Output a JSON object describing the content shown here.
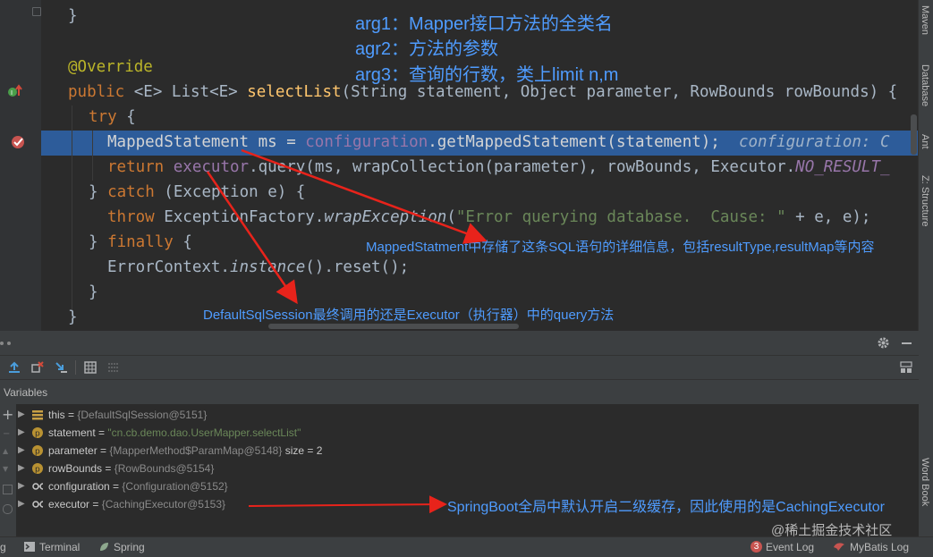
{
  "editor": {
    "lines": {
      "l0": "}",
      "l2_annotation": "@Override",
      "l3": {
        "kw": "public",
        "generic1": "<E>",
        "type": "List",
        "generic2": "<E>",
        "method": "selectList",
        "params": "(String statement, Object parameter, RowBounds rowBounds) {"
      },
      "l4": {
        "kw": "try",
        "rest": " {"
      },
      "l5": {
        "type": "MappedStatement",
        "var": " ms = ",
        "field": "configuration",
        "call": ".getMappedStatement(statement);",
        "hint": "configuration: C"
      },
      "l6": {
        "kw": "return",
        "field": "executor",
        "call": ".query(ms, wrapCollection(parameter), rowBounds, Executor.",
        "const": "NO_RESULT_"
      },
      "l7": {
        "pre": "} ",
        "kw": "catch",
        "rest": " (Exception e) {"
      },
      "l8": {
        "kw": "throw",
        "cls": " ExceptionFactory.",
        "method": "wrapException",
        "open": "(",
        "str": "\"Error querying database.  Cause: \"",
        "rest": " + e, e);"
      },
      "l9": {
        "pre": "} ",
        "kw": "finally",
        "rest": " {"
      },
      "l10": {
        "cls": "ErrorContext.",
        "method": "instance",
        "rest": "().reset();"
      },
      "l11": "}",
      "l12": "}"
    }
  },
  "notes": {
    "arg1": "arg1：Mapper接口方法的全类名",
    "arg2": "agr2：方法的参数",
    "arg3": "arg3：查询的行数，类上limit n,m",
    "mapped": "MappedStatment中存储了这条SQL语句的详细信息，包括resultType,resultMap等内容",
    "default": "DefaultSqlSession最终调用的还是Executor（执行器）中的query方法",
    "springboot": "SpringBoot全局中默认开启二级缓存，因此使用的是CachingExecutor"
  },
  "right_tabs": {
    "maven": "Maven",
    "database": "Database",
    "ant": "Ant",
    "structure": "Z: Structure",
    "wordbook": "Word Book"
  },
  "debug": {
    "variables_label": "Variables",
    "vars": [
      {
        "name": "this",
        "value": "{DefaultSqlSession@5151}",
        "icon": "field-list-icon"
      },
      {
        "name": "statement",
        "value": "\"cn.cb.demo.dao.UserMapper.selectList\"",
        "icon": "param-icon"
      },
      {
        "name": "parameter",
        "value": "{MapperMethod$ParamMap@5148}",
        "extra": " size = 2",
        "icon": "param-icon"
      },
      {
        "name": "rowBounds",
        "value": "{RowBounds@5154}",
        "icon": "param-icon"
      },
      {
        "name": "configuration",
        "value": "{Configuration@5152}",
        "icon": "glasses-icon"
      },
      {
        "name": "executor",
        "value": "{CachingExecutor@5153}",
        "icon": "glasses-icon"
      }
    ]
  },
  "statusbar": {
    "left_fragment": "g",
    "terminal": "Terminal",
    "spring": "Spring",
    "event_badge": "3",
    "event_log": "Event Log",
    "mybatis_log": "MyBatis Log",
    "watermark": "@稀土掘金技术社区"
  },
  "colors": {
    "highlight": "#2d5c9a",
    "annotation_text": "#4f9cff",
    "arrow": "#e8231b"
  }
}
